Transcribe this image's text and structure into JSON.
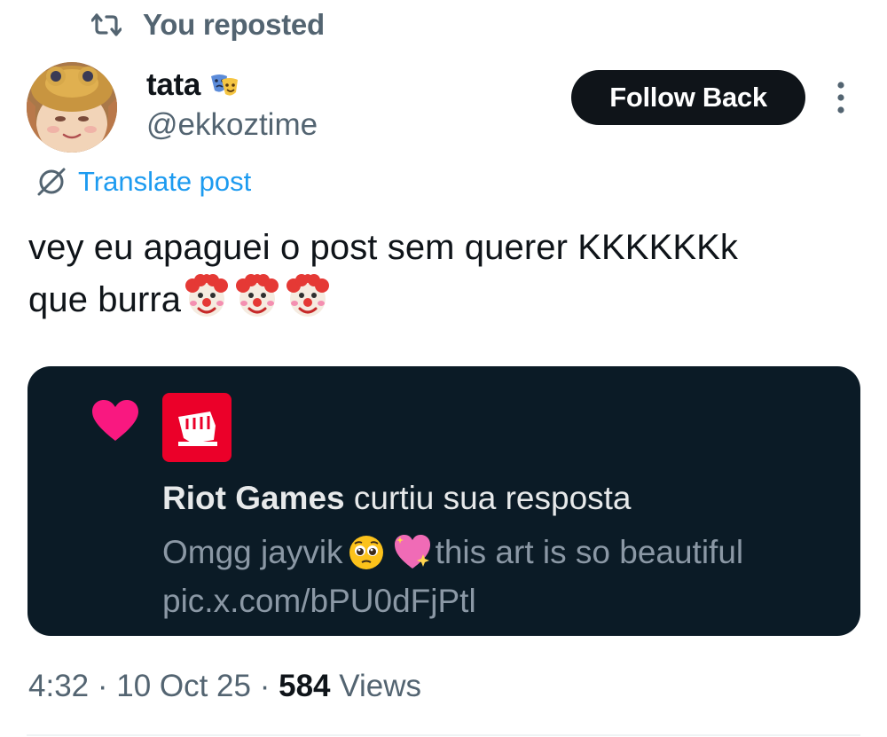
{
  "repost": {
    "label": "You reposted",
    "icon": "repost-icon"
  },
  "author": {
    "display_name": "tata",
    "name_emoji": "performing-arts-icon",
    "handle": "@ekkoztime",
    "avatar": "avatar"
  },
  "actions": {
    "follow_label": "Follow Back",
    "more_icon": "more-vertical-icon"
  },
  "translate": {
    "label": "Translate post",
    "icon": "translate-icon"
  },
  "post": {
    "line1": "vey eu apaguei o post sem querer KKKKKKk",
    "line2": "que burra",
    "trailing_emoji": "clown-face-icon"
  },
  "embedded": {
    "icon": "heart-icon",
    "sender": "Riot Games",
    "action": " curtiu sua resposta",
    "reply_before": "Omgg jayvik",
    "reply_after": " this art is so beautiful",
    "reply_link": "pic.x.com/bPU0dFjPtl",
    "colors": {
      "background": "#0b1b26",
      "heart": "#f91880",
      "logo": "#eb0029"
    }
  },
  "meta": {
    "time": "4:32",
    "sep1": " · ",
    "date": "10 Oct 25",
    "sep2": " · ",
    "views_count": "584",
    "views_label": " Views"
  },
  "colors": {
    "primary_text": "#0f1419",
    "secondary_text": "#536471",
    "link": "#1d9bf0"
  }
}
